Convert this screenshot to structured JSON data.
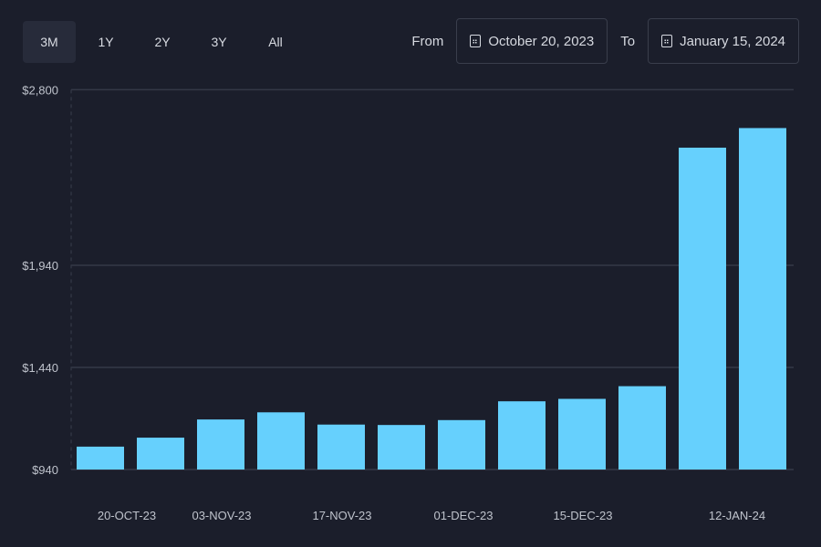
{
  "range_tabs": [
    {
      "label": "3M",
      "active": true
    },
    {
      "label": "1Y"
    },
    {
      "label": "2Y"
    },
    {
      "label": "3Y"
    },
    {
      "label": "All"
    }
  ],
  "date_range": {
    "from_label": "From",
    "from_value": "October 20, 2023",
    "to_label": "To",
    "to_value": "January 15, 2024",
    "icon": "calendar-icon"
  },
  "chart_data": {
    "type": "bar",
    "title": "",
    "xlabel": "",
    "ylabel": "",
    "ylim": [
      940,
      2800
    ],
    "yticks": [
      "$940",
      "$1,440",
      "$1,940",
      "$2,800"
    ],
    "ytick_values": [
      940,
      1440,
      1940,
      2800
    ],
    "xtick_labels": [
      "20-OCT-23",
      "03-NOV-23",
      "17-NOV-23",
      "01-DEC-23",
      "15-DEC-23",
      "12-JAN-24"
    ],
    "values": [
      1052,
      1096,
      1185,
      1220,
      1160,
      1158,
      1182,
      1274,
      1286,
      1348,
      2516,
      2612
    ],
    "bar_color": "#66d0fd",
    "grid": true
  }
}
